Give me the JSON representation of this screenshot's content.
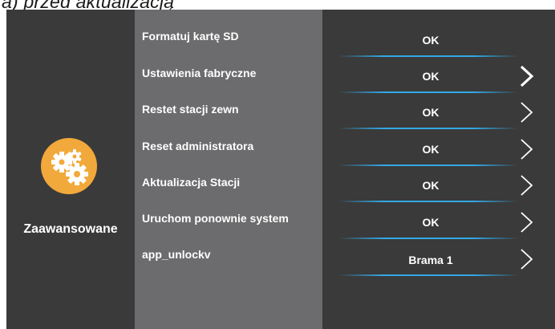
{
  "caption": "a)  przed aktualizacją",
  "section": {
    "title": "Zaawansowane",
    "icon": "gears-icon"
  },
  "colors": {
    "accent": "#f2a93b",
    "underline": "#32a9e6",
    "panel_dark": "#3a3a3a",
    "panel_mid": "#6c6c6e"
  },
  "options": [
    {
      "label": "Formatuj kartę SD",
      "value": "OK",
      "has_arrow": false
    },
    {
      "label": "Ustawienia fabryczne",
      "value": "OK",
      "has_arrow": true
    },
    {
      "label": "Restet stacji zewn",
      "value": "OK",
      "has_arrow": true
    },
    {
      "label": "Reset administratora",
      "value": "OK",
      "has_arrow": true
    },
    {
      "label": "Aktualizacja Stacji",
      "value": "OK",
      "has_arrow": true
    },
    {
      "label": "Uruchom ponownie system",
      "value": "OK",
      "has_arrow": true
    },
    {
      "label": "app_unlockv",
      "value": "Brama 1",
      "has_arrow": true
    }
  ]
}
